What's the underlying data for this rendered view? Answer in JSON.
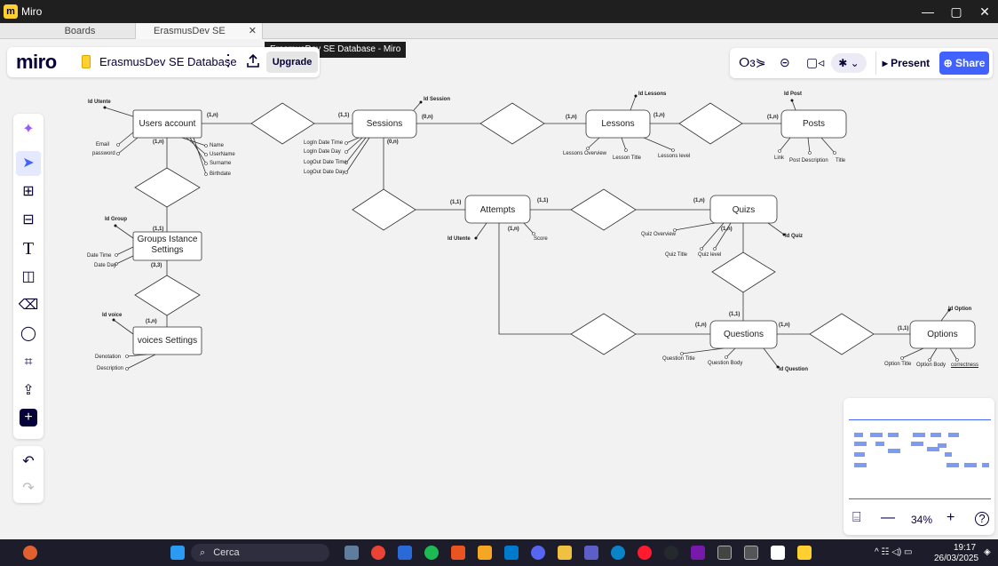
{
  "window": {
    "app_name": "Miro",
    "min": "—",
    "max": "▢",
    "close": "✕"
  },
  "tabs": {
    "boards": "Boards",
    "active": "ErasmusDev SE Databas...",
    "close": "✕"
  },
  "tooltip": "ErasmusDev SE Database - Miro",
  "boardbar": {
    "logo": "miro",
    "board_name": "ErasmusDev SE Database",
    "more": "⋮",
    "upgrade": "Upgrade"
  },
  "collab": {
    "reactions": "ⵔɜ⋟",
    "chat": "⊝",
    "video": "▢◃",
    "avatar": "✱ ⌄",
    "present": "▸ Present",
    "share": "⊕ Share"
  },
  "toolbar": {
    "ai": "✦",
    "select": "➤",
    "templates": "⊞",
    "frame": "⊟",
    "text": "T",
    "sticky": "◫",
    "eraser": "⌫",
    "comment": "◯",
    "crop": "⌗",
    "upload": "⇪",
    "add": "+",
    "undo": "↶",
    "redo": "↷"
  },
  "minimap": {
    "fit": "⌸",
    "zoom_out": "—",
    "zoom_level": "34%",
    "zoom_in": "+",
    "help": "?"
  },
  "taskbar": {
    "search": "Cerca",
    "time": "19:17",
    "date": "26/03/2025",
    "tray": "^  ☷ ◁) ▭"
  },
  "diagram": {
    "entities": {
      "users": "Users account",
      "sessions": "Sessions",
      "lessons": "Lessons",
      "posts": "Posts",
      "groups": "Groups Istance Settings",
      "attempts": "Attempts",
      "quizs": "Quizs",
      "voices": "voices Settings",
      "questions": "Questions",
      "options": "Options"
    },
    "labels": {
      "id_utente": "Id Utente",
      "id_session": "Id Session",
      "id_lessons": "Id Lessons",
      "id_post": "Id Post",
      "email": "Email",
      "password": "password",
      "name": "Name",
      "username": "UserName",
      "surname": "Surname",
      "birthdate": "Birthdate",
      "login_time": "LogIn Date Time",
      "login_day": "LogIn Date Day",
      "logout_time": "LogOut Date Time",
      "logout_day": "LogOut Date Day",
      "lessons_overview": "Lessons Overview",
      "lesson_title": "Lesson Title",
      "lessons_level": "Lessons level",
      "link": "Link",
      "post_description": "Post Description",
      "title": "Title",
      "id_group": "Id Group",
      "date_time": "Date Time",
      "date_day": "Date Day",
      "id_voice": "Id voice",
      "denotation": "Denotation",
      "description": "Description",
      "id_utente2": "Id Utente",
      "score": "Score",
      "quiz_overview": "Quiz Overview",
      "quiz_title": "Quiz Title",
      "quiz_level": "Quiz level",
      "id_quiz": "Id Quiz",
      "question_title": "Question Title",
      "question_body": "Question Body",
      "id_question": "Id Question",
      "id_option": "Id Option",
      "option_title": "Option Title",
      "option_body": "Option Body",
      "correctness": "correctness"
    },
    "cards": {
      "c1": "(1,n)",
      "c2": "(1,1)",
      "c3": "(0,n)",
      "c4": "(1,n)",
      "c5": "(1,n)",
      "c6": "(1,n)",
      "c7": "(1,n)",
      "c8": "(0,n)",
      "c9": "(1,1)",
      "c10": "(3,3)",
      "c11": "(1,n)",
      "c12": "(1,1)",
      "c13": "(1,1)",
      "c14": "(1,n)",
      "c15": "(1,n)",
      "c16": "(1,n)",
      "c17": "(1,1)",
      "c18": "(1,n)",
      "c19": "(1,n)",
      "c20": "(1,1)"
    }
  }
}
